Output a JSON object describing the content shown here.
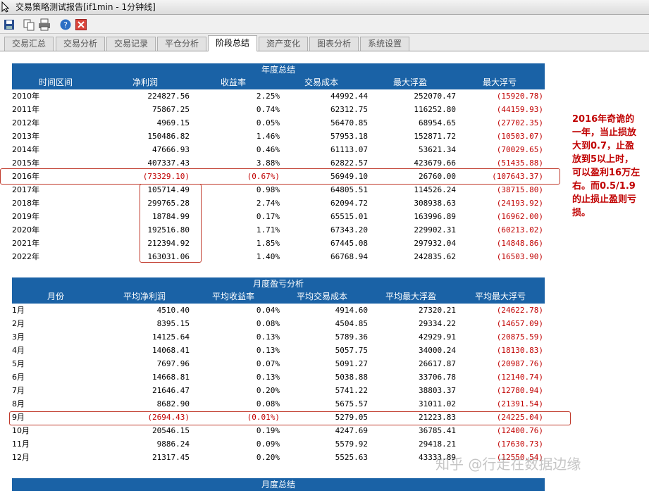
{
  "window": {
    "title": "交易策略测试报告[if1min - 1分钟线]"
  },
  "tabs": [
    "交易汇总",
    "交易分析",
    "交易记录",
    "平仓分析",
    "阶段总结",
    "资产变化",
    "图表分析",
    "系统设置"
  ],
  "active_tab": "阶段总结",
  "yearly": {
    "title": "年度总结",
    "headers": [
      "时间区间",
      "净利润",
      "收益率",
      "交易成本",
      "最大浮盈",
      "最大浮亏"
    ],
    "rows": [
      [
        "2010年",
        "224827.56",
        "2.25%",
        "44992.44",
        "252070.47",
        "(15920.78)"
      ],
      [
        "2011年",
        "75867.25",
        "0.74%",
        "62312.75",
        "116252.80",
        "(44159.93)"
      ],
      [
        "2012年",
        "4969.15",
        "0.05%",
        "56470.85",
        "68954.65",
        "(27702.35)"
      ],
      [
        "2013年",
        "150486.82",
        "1.46%",
        "57953.18",
        "152871.72",
        "(10503.07)"
      ],
      [
        "2014年",
        "47666.93",
        "0.46%",
        "61113.07",
        "53621.34",
        "(70029.65)"
      ],
      [
        "2015年",
        "407337.43",
        "3.88%",
        "62822.57",
        "423679.66",
        "(51435.88)"
      ],
      [
        "2016年",
        "(73329.10)",
        "(0.67%)",
        "56949.10",
        "26760.00",
        "(107643.37)"
      ],
      [
        "2017年",
        "105714.49",
        "0.98%",
        "64805.51",
        "114526.24",
        "(38715.80)"
      ],
      [
        "2018年",
        "299765.28",
        "2.74%",
        "62094.72",
        "308938.63",
        "(24193.92)"
      ],
      [
        "2019年",
        "18784.99",
        "0.17%",
        "65515.01",
        "163996.89",
        "(16962.00)"
      ],
      [
        "2020年",
        "192516.80",
        "1.71%",
        "67343.20",
        "229902.31",
        "(60213.02)"
      ],
      [
        "2021年",
        "212394.92",
        "1.85%",
        "67445.08",
        "297932.04",
        "(14848.86)"
      ],
      [
        "2022年",
        "163031.06",
        "1.40%",
        "66768.94",
        "242835.62",
        "(16503.90)"
      ]
    ]
  },
  "monthly": {
    "title": "月度盈亏分析",
    "headers": [
      "月份",
      "平均净利润",
      "平均收益率",
      "平均交易成本",
      "平均最大浮盈",
      "平均最大浮亏"
    ],
    "rows": [
      [
        "1月",
        "4510.40",
        "0.04%",
        "4914.60",
        "27320.21",
        "(24622.78)"
      ],
      [
        "2月",
        "8395.15",
        "0.08%",
        "4504.85",
        "29334.22",
        "(14657.09)"
      ],
      [
        "3月",
        "14125.64",
        "0.13%",
        "5789.36",
        "42929.91",
        "(20875.59)"
      ],
      [
        "4月",
        "14068.41",
        "0.13%",
        "5057.75",
        "34000.24",
        "(18130.83)"
      ],
      [
        "5月",
        "7697.96",
        "0.07%",
        "5091.27",
        "26617.87",
        "(20987.76)"
      ],
      [
        "6月",
        "14668.81",
        "0.13%",
        "5038.88",
        "33706.78",
        "(12140.74)"
      ],
      [
        "7月",
        "21646.47",
        "0.20%",
        "5741.22",
        "38803.37",
        "(12780.94)"
      ],
      [
        "8月",
        "8682.90",
        "0.08%",
        "5675.57",
        "31011.02",
        "(21391.54)"
      ],
      [
        "9月",
        "(2694.43)",
        "(0.01%)",
        "5279.05",
        "21223.83",
        "(24225.04)"
      ],
      [
        "10月",
        "20546.15",
        "0.19%",
        "4247.69",
        "36785.41",
        "(12400.76)"
      ],
      [
        "11月",
        "9886.24",
        "0.09%",
        "5579.92",
        "29418.21",
        "(17630.73)"
      ],
      [
        "12月",
        "21317.45",
        "0.20%",
        "5525.63",
        "43333.89",
        "(12550.54)"
      ]
    ]
  },
  "monthly_summary": {
    "title": "月度总结"
  },
  "annotation": "2016年奇诡的一年，当止损放大到0.7，止盈放到5以上时，可以盈利16万左右。而0.5/1.9的止损止盈则亏损。",
  "watermark": "知乎 @行走在数据边缘",
  "colors": {
    "header_bg": "#1a62a6",
    "negative": "#c00000",
    "highlight_box": "#c0392b"
  }
}
